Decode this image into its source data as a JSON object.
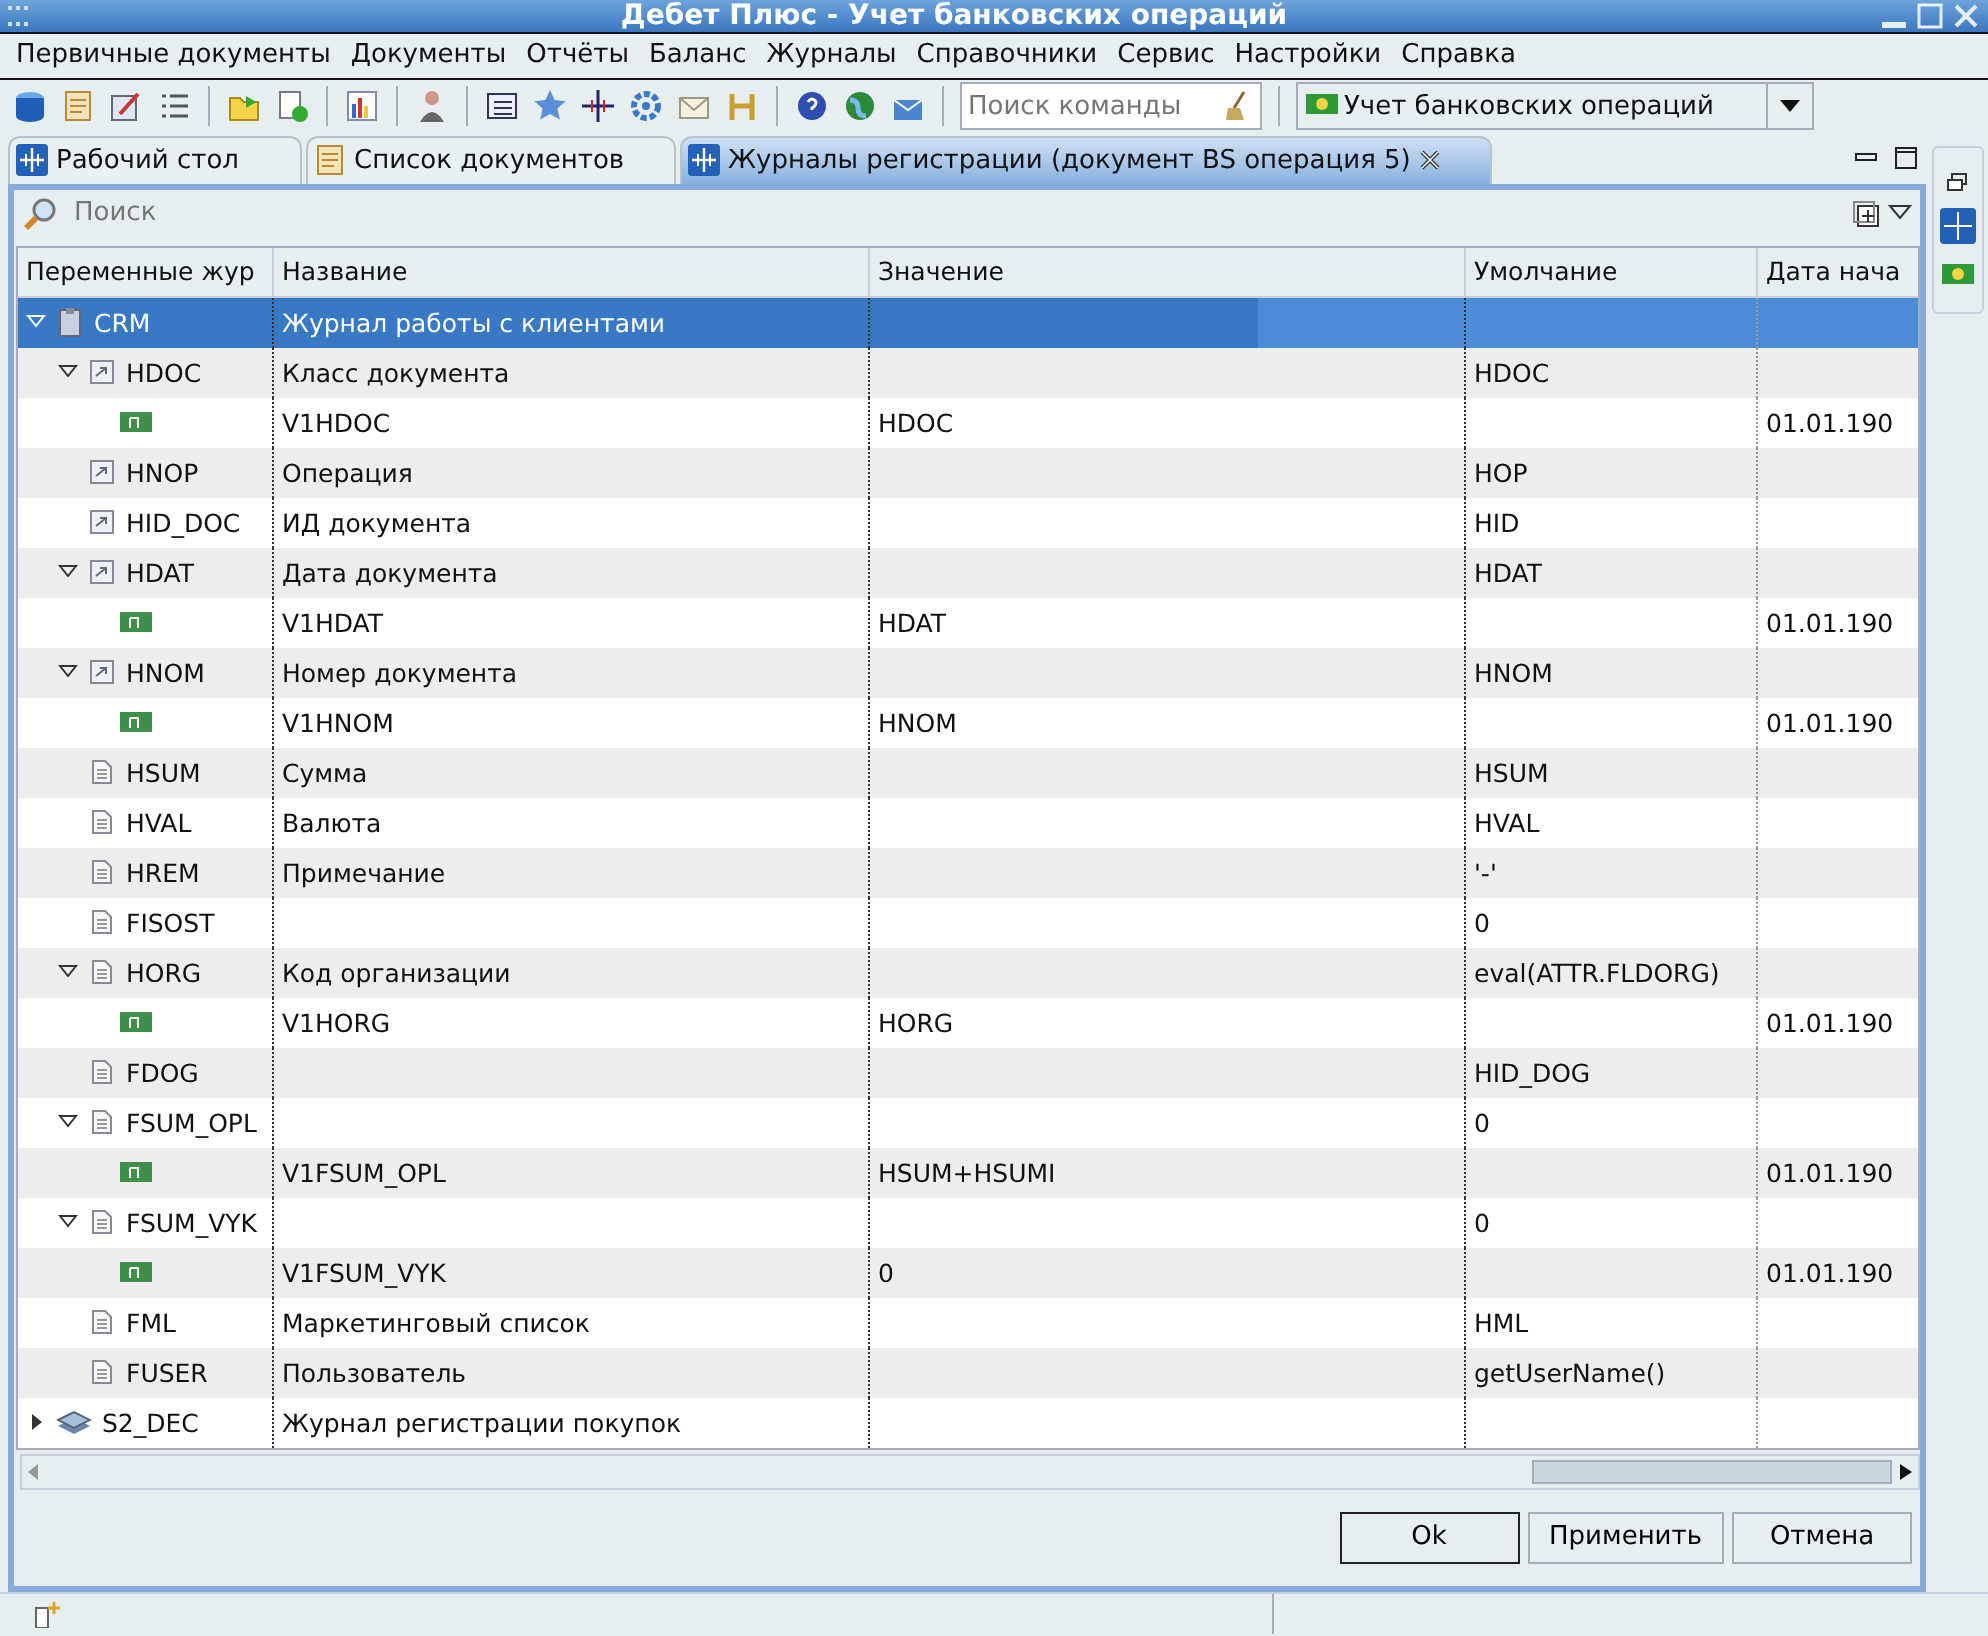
{
  "window": {
    "title": "Дебет Плюс - Учет банковских операций"
  },
  "menu": [
    "Первичные документы",
    "Документы",
    "Отчёты",
    "Баланс",
    "Журналы",
    "Справочники",
    "Сервис",
    "Настройки",
    "Справка"
  ],
  "toolbar": {
    "command_search": {
      "placeholder": "Поиск команды"
    },
    "module_select": {
      "value": "Учет банковских операций"
    }
  },
  "tabs": [
    {
      "label": "Рабочий стол",
      "selected": false,
      "kind": "desk"
    },
    {
      "label": "Список документов",
      "selected": false,
      "kind": "list"
    },
    {
      "label": "Журналы регистрации (документ BS операция 5)",
      "selected": true,
      "kind": "desk",
      "closable": true
    }
  ],
  "search": {
    "placeholder": "Поиск"
  },
  "table": {
    "columns": [
      "Переменные жур",
      "Название",
      "Значение",
      "Умолчание",
      "Дата нача"
    ],
    "rows": [
      {
        "kind": "journal",
        "code": "CRM",
        "name": "Журнал работы с клиентами",
        "expanded": true,
        "selected": true,
        "children": [
          {
            "kind": "linked",
            "code": "HDOC",
            "name": "Класс документа",
            "default": "HDOC",
            "expanded": true,
            "selected": false,
            "children": [
              {
                "kind": "value",
                "name": "V1HDOC",
                "value": "HDOC",
                "date": "01.01.190",
                "selected": false
              }
            ]
          },
          {
            "kind": "linked",
            "code": "HNOP",
            "name": "Операция",
            "default": "HOP",
            "selected": false
          },
          {
            "kind": "linked",
            "code": "HID_DOC",
            "name": "ИД документа",
            "default": "HID",
            "selected": false
          },
          {
            "kind": "linked",
            "code": "HDAT",
            "name": "Дата документа",
            "default": "HDAT",
            "expanded": true,
            "selected": false,
            "children": [
              {
                "kind": "value",
                "name": "V1HDAT",
                "value": "HDAT",
                "date": "01.01.190",
                "selected": false
              }
            ]
          },
          {
            "kind": "linked",
            "code": "HNOM",
            "name": "Номер документа",
            "default": "HNOM",
            "expanded": true,
            "selected": false,
            "children": [
              {
                "kind": "value",
                "name": "V1HNOM",
                "value": "HNOM",
                "date": "01.01.190",
                "selected": false
              }
            ]
          },
          {
            "kind": "field",
            "code": "HSUM",
            "name": "Сумма",
            "default": "HSUM",
            "selected": false
          },
          {
            "kind": "field",
            "code": "HVAL",
            "name": "Валюта",
            "default": "HVAL",
            "selected": false
          },
          {
            "kind": "field",
            "code": "HREM",
            "name": "Примечание",
            "default": "'-'",
            "selected": false
          },
          {
            "kind": "field",
            "code": "FISOST",
            "default": "0",
            "selected": false
          },
          {
            "kind": "field",
            "code": "HORG",
            "name": "Код организации",
            "default": "eval(ATTR.FLDORG)",
            "expanded": true,
            "selected": false,
            "children": [
              {
                "kind": "value",
                "name": "V1HORG",
                "value": "HORG",
                "date": "01.01.190",
                "selected": false
              }
            ]
          },
          {
            "kind": "field",
            "code": "FDOG",
            "default": "HID_DOG",
            "selected": false
          },
          {
            "kind": "field",
            "code": "FSUM_OPL",
            "default": "0",
            "expanded": true,
            "selected": false,
            "children": [
              {
                "kind": "value",
                "name": "V1FSUM_OPL",
                "value": "HSUM+HSUMI",
                "date": "01.01.190",
                "selected": false
              }
            ]
          },
          {
            "kind": "field",
            "code": "FSUM_VYK",
            "default": "0",
            "expanded": true,
            "selected": false,
            "children": [
              {
                "kind": "value",
                "name": "V1FSUM_VYK",
                "value": "0",
                "date": "01.01.190",
                "selected": false
              }
            ]
          },
          {
            "kind": "field",
            "code": "FML",
            "name": "Маркетинговый список",
            "default": "HML",
            "selected": false
          },
          {
            "kind": "field",
            "code": "FUSER",
            "name": "Пользователь",
            "default": "getUserName()",
            "selected": false
          }
        ]
      },
      {
        "kind": "journal2",
        "code": "S2_DEC",
        "name": "Журнал регистрации покупок",
        "expanded": false,
        "selected": false
      }
    ]
  },
  "buttons": [
    {
      "label": "Ok",
      "default": true
    },
    {
      "label": "Применить",
      "default": false
    },
    {
      "label": "Отмена",
      "default": false
    }
  ]
}
